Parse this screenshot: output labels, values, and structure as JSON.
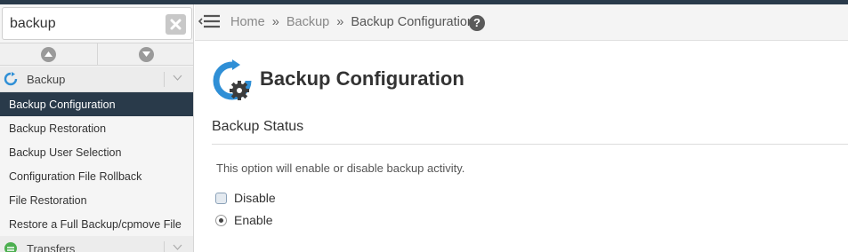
{
  "search": {
    "value": "backup",
    "placeholder": ""
  },
  "sidebar": {
    "groups": [
      {
        "label": "Backup",
        "icon": "backup-refresh-icon"
      },
      {
        "label": "Transfers",
        "icon": "transfers-icon"
      }
    ],
    "items": [
      {
        "label": "Backup Configuration",
        "active": true
      },
      {
        "label": "Backup Restoration"
      },
      {
        "label": "Backup User Selection"
      },
      {
        "label": "Configuration File Rollback"
      },
      {
        "label": "File Restoration"
      },
      {
        "label": "Restore a Full Backup/cpmove File"
      }
    ]
  },
  "breadcrumb": {
    "home": "Home",
    "sep": "»",
    "section": "Backup",
    "current": "Backup Configuration",
    "help": "?"
  },
  "main": {
    "title": "Backup Configuration",
    "section_title": "Backup Status",
    "description": "This option will enable or disable backup activity.",
    "options": [
      {
        "label": "Disable",
        "selected": false
      },
      {
        "label": "Enable",
        "selected": true
      }
    ]
  },
  "colors": {
    "nav_active": "#293a4a",
    "accent_blue": "#2f8fd6",
    "gear": "#3c3c3c"
  }
}
